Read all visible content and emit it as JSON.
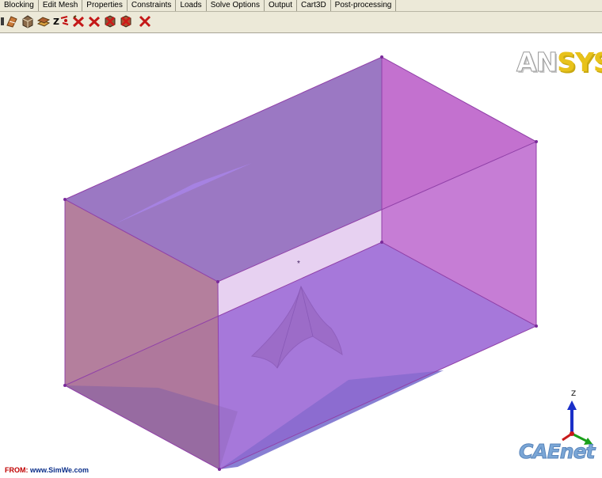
{
  "menu": {
    "tabs": [
      "Blocking",
      "Edit Mesh",
      "Properties",
      "Constraints",
      "Loads",
      "Solve Options",
      "Output",
      "Cart3D",
      "Post-processing"
    ]
  },
  "toolbar": {
    "icons": [
      "create-block-icon",
      "split-block-icon",
      "merge-vertices-icon",
      "edit-block-icon",
      "associate-icon",
      "transform-blocks-icon",
      "edit-edge-icon",
      "delete-block-icon",
      "pre-mesh-params-icon",
      "pre-mesh-quality-icon",
      "pre-mesh-smooth-icon",
      "delete-icon"
    ],
    "letters": "Z"
  },
  "branding": {
    "logo_part1": "AN",
    "logo_part2": "SYS",
    "watermark": "CAEnet",
    "source_label": "FROM:",
    "source_url": "www.SimWe.com"
  },
  "triad": {
    "z_label": "Z",
    "colors": {
      "z": "#1a2fc8",
      "x": "#c81a1a",
      "y": "#1aa01a"
    }
  },
  "colors": {
    "left_face": "#b07898",
    "right_face": "#c870d0",
    "top_face": "#8a60b8",
    "bottom_face": "#9068d8",
    "front_face": "#b97ad8",
    "edge": "#9040a8",
    "menu_bg": "#ece9d8"
  }
}
